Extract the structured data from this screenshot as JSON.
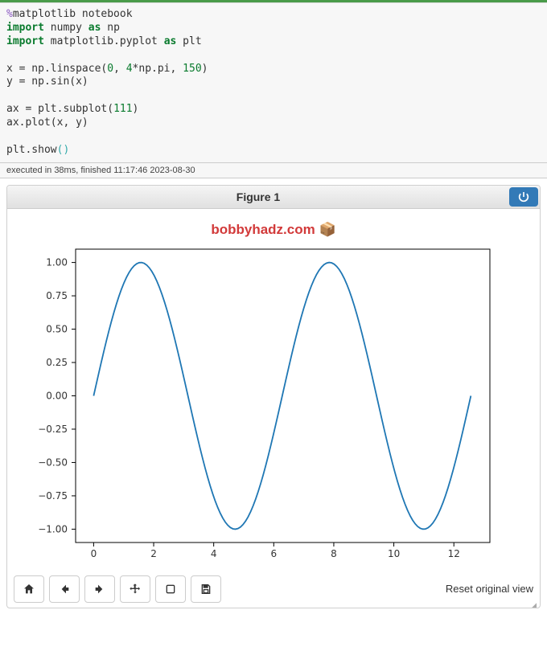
{
  "code": {
    "lines": [
      {
        "segments": [
          {
            "t": "%",
            "c": "magic"
          },
          {
            "t": "matplotlib notebook"
          }
        ]
      },
      {
        "segments": [
          {
            "t": "import",
            "c": "kw"
          },
          {
            "t": " numpy "
          },
          {
            "t": "as",
            "c": "kw"
          },
          {
            "t": " np"
          }
        ]
      },
      {
        "segments": [
          {
            "t": "import",
            "c": "kw"
          },
          {
            "t": " matplotlib.pyplot "
          },
          {
            "t": "as",
            "c": "kw"
          },
          {
            "t": " plt"
          }
        ]
      },
      {
        "segments": [
          {
            "t": ""
          }
        ]
      },
      {
        "segments": [
          {
            "t": "x = np.linspace("
          },
          {
            "t": "0",
            "c": "num"
          },
          {
            "t": ", "
          },
          {
            "t": "4",
            "c": "num"
          },
          {
            "t": "*np.pi, "
          },
          {
            "t": "150",
            "c": "num"
          },
          {
            "t": ")"
          }
        ]
      },
      {
        "segments": [
          {
            "t": "y = np.sin(x)"
          }
        ]
      },
      {
        "segments": [
          {
            "t": ""
          }
        ]
      },
      {
        "segments": [
          {
            "t": "ax = plt.subplot("
          },
          {
            "t": "111",
            "c": "num"
          },
          {
            "t": ")"
          }
        ]
      },
      {
        "segments": [
          {
            "t": "ax.plot(x, y)"
          }
        ]
      },
      {
        "segments": [
          {
            "t": ""
          }
        ]
      },
      {
        "segments": [
          {
            "t": "plt.show"
          },
          {
            "t": "()",
            "c": "bracket-teal"
          }
        ]
      }
    ]
  },
  "exec_info": "executed in 38ms, finished 11:17:46 2023-08-30",
  "figure": {
    "title": "Figure 1",
    "watermark_text": "bobbyhadz.com",
    "watermark_emoji": "📦"
  },
  "chart_data": {
    "type": "line",
    "title": "",
    "xlabel": "",
    "ylabel": "",
    "x_start": 0,
    "x_end": 12.566370614,
    "n_points": 150,
    "function": "sin",
    "xlim": [
      -0.6,
      13.2
    ],
    "ylim": [
      -1.1,
      1.1
    ],
    "xticks": [
      0,
      2,
      4,
      6,
      8,
      10,
      12
    ],
    "yticks": [
      -1.0,
      -0.75,
      -0.5,
      -0.25,
      0.0,
      0.25,
      0.5,
      0.75,
      1.0
    ],
    "line_color": "#1f77b4"
  },
  "toolbar": {
    "buttons": [
      "home",
      "back",
      "forward",
      "pan",
      "zoom",
      "save"
    ],
    "status": "Reset original view"
  }
}
